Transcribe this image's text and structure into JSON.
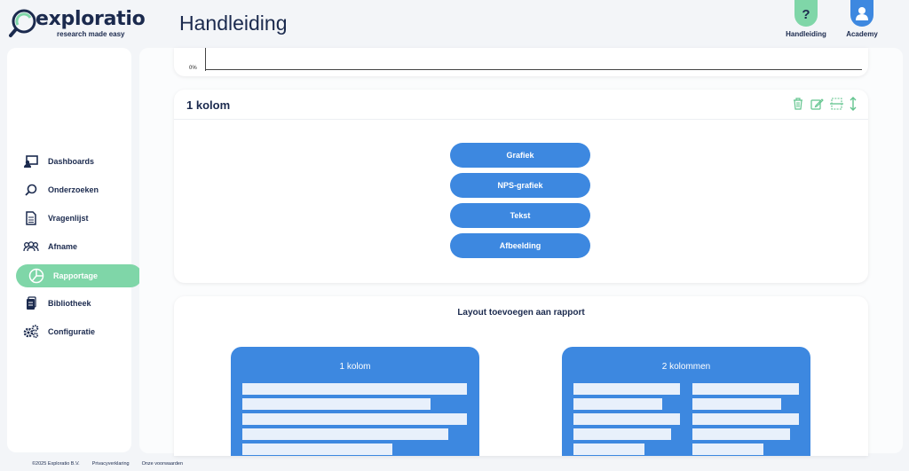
{
  "brand": {
    "name": "exploratio",
    "tagline": "research made easy",
    "accent_green": "#7fd6a8",
    "accent_blue": "#3d88e0"
  },
  "header": {
    "title": "Handleiding",
    "buttons": [
      {
        "label": "Handleiding",
        "icon": "question-icon"
      },
      {
        "label": "Academy",
        "icon": "user-icon"
      }
    ]
  },
  "sidebar": {
    "items": [
      {
        "label": "Dashboards",
        "icon": "dashboard-icon",
        "active": false
      },
      {
        "label": "Onderzoeken",
        "icon": "search-icon",
        "active": false
      },
      {
        "label": "Vragenlijst",
        "icon": "document-icon",
        "active": false
      },
      {
        "label": "Afname",
        "icon": "group-icon",
        "active": false
      },
      {
        "label": "Rapportage",
        "icon": "pie-chart-icon",
        "active": true
      },
      {
        "label": "Bibliotheek",
        "icon": "library-icon",
        "active": false
      },
      {
        "label": "Configuratie",
        "icon": "gears-icon",
        "active": false
      }
    ]
  },
  "chart_card": {
    "axis_label": "0%"
  },
  "column_card": {
    "title": "1 kolom",
    "tools": [
      "trash-icon",
      "edit-icon",
      "split-icon",
      "resize-vertical-icon"
    ],
    "options": [
      "Grafiek",
      "NPS-grafiek",
      "Tekst",
      "Afbeelding"
    ]
  },
  "layout_card": {
    "title": "Layout toevoegen aan rapport",
    "templates": [
      {
        "label": "1 kolom"
      },
      {
        "label": "2 kolommen"
      }
    ]
  },
  "footer": {
    "copyright": "©2025 Exploratio B.V.",
    "privacy": "Privacyverklaring",
    "terms": "Onze voorwaarden"
  }
}
